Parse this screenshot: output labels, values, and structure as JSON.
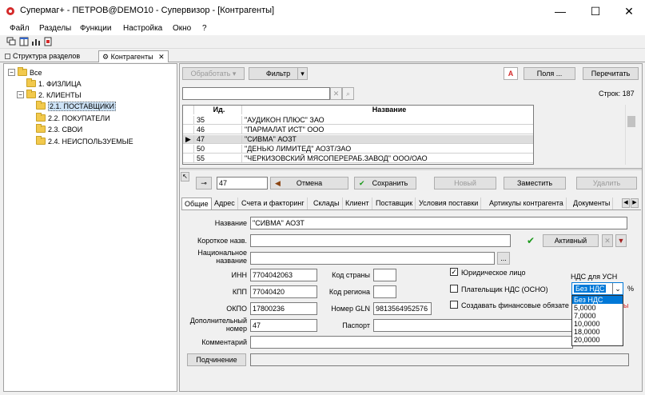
{
  "window": {
    "title": "Супермаг+ - ПЕТРОВ@DEMO10 - Супервизор  - [Контрагенты]",
    "min_glyph": "—",
    "max_glyph": "☐",
    "close_glyph": "✕"
  },
  "menu": [
    "Файл",
    "Разделы",
    "Функции",
    "Настройка",
    "Окно",
    "?"
  ],
  "doc_tabs": {
    "structure": "Структура разделов",
    "contractors": "Контрагенты",
    "close_glyph": "✕"
  },
  "tree": {
    "root": "Все",
    "items": [
      {
        "label": "1. ФИЗЛИЦА"
      },
      {
        "label": "2. КЛИЕНТЫ"
      },
      {
        "label": "2.1. ПОСТАВЩИКИ"
      },
      {
        "label": "2.2. ПОКУПАТЕЛИ"
      },
      {
        "label": "2.3. СВОИ"
      },
      {
        "label": "2.4. НЕИСПОЛЬЗУЕМЫЕ"
      }
    ]
  },
  "list_toolbar": {
    "process": "Обработать",
    "filter": "Фильтр",
    "a_label": "A",
    "fields": "Поля ...",
    "recalc": "Перечитать",
    "rows_count": "Строк: 187"
  },
  "grid": {
    "headers": [
      "Ид.",
      "Название"
    ],
    "rows": [
      {
        "id": "35",
        "name": "\"АУДИКОН ПЛЮС\" ЗАО"
      },
      {
        "id": "46",
        "name": "\"ПАРМАЛАТ ИСТ\" ООО"
      },
      {
        "id": "47",
        "name": "\"СИВМА\" АОЗТ"
      },
      {
        "id": "50",
        "name": "\"ДЕНЬЮ ЛИМИТЕД\" АОЗТ/ЗАО"
      },
      {
        "id": "55",
        "name": "\"ЧЕРКИЗОВСКИЙ МЯСОПЕРЕРАБ.ЗАВОД\" ООО/ОАО"
      }
    ],
    "selected_index": 2
  },
  "form_toolbar": {
    "id_value": "47",
    "cancel": "Отмена",
    "save": "Сохранить",
    "new": "Новый",
    "replace": "Заместить",
    "delete": "Удалить"
  },
  "form_tabs": [
    "Общие",
    "Адрес",
    "Счета и факторинг",
    "Склады",
    "Клиент",
    "Поставщик",
    "Условия поставки",
    "Артикулы контрагента",
    "Документы"
  ],
  "form": {
    "name_label": "Название",
    "name_value": "\"СИВМА\" АОЗТ",
    "short_label": "Короткое назв.",
    "short_value": "",
    "status_button": "Активный",
    "national_label_1": "Национальное",
    "national_label_2": "название",
    "national_value": "",
    "ellipsis": "...",
    "inn_label": "ИНН",
    "inn_value": "7704042063",
    "country_code_label": "Код страны",
    "country_code_value": "",
    "kpp_label": "КПП",
    "kpp_value": "77040420",
    "region_code_label": "Код региона",
    "region_code_value": "",
    "okpo_label": "ОКПО",
    "okpo_value": "17800236",
    "gln_label": "Номер GLN",
    "gln_value": "9813564952576",
    "extra_number_label_1": "Дополнительный",
    "extra_number_label_2": "номер",
    "extra_number_value": "47",
    "passport_label": "Паспорт",
    "passport_value": "",
    "comment_label": "Комментарий",
    "comment_value": "",
    "subordination_button": "Подчинение",
    "legal_entity_label": "Юридическое лицо",
    "legal_entity_checked": true,
    "vat_payer_label": "Плательщик НДС (ОСНО)",
    "vat_payer_checked": false,
    "create_fin_label": "Создавать финансовые обязате",
    "create_fin_checked": false,
    "vat_usn_label": "НДС для УСН",
    "vat_usn_selected": "Без НДС",
    "percent_sign": "%",
    "vat_options": [
      "Без НДС",
      "5,0000",
      "7,0000",
      "10,0000",
      "18,0000",
      "20,0000"
    ]
  }
}
